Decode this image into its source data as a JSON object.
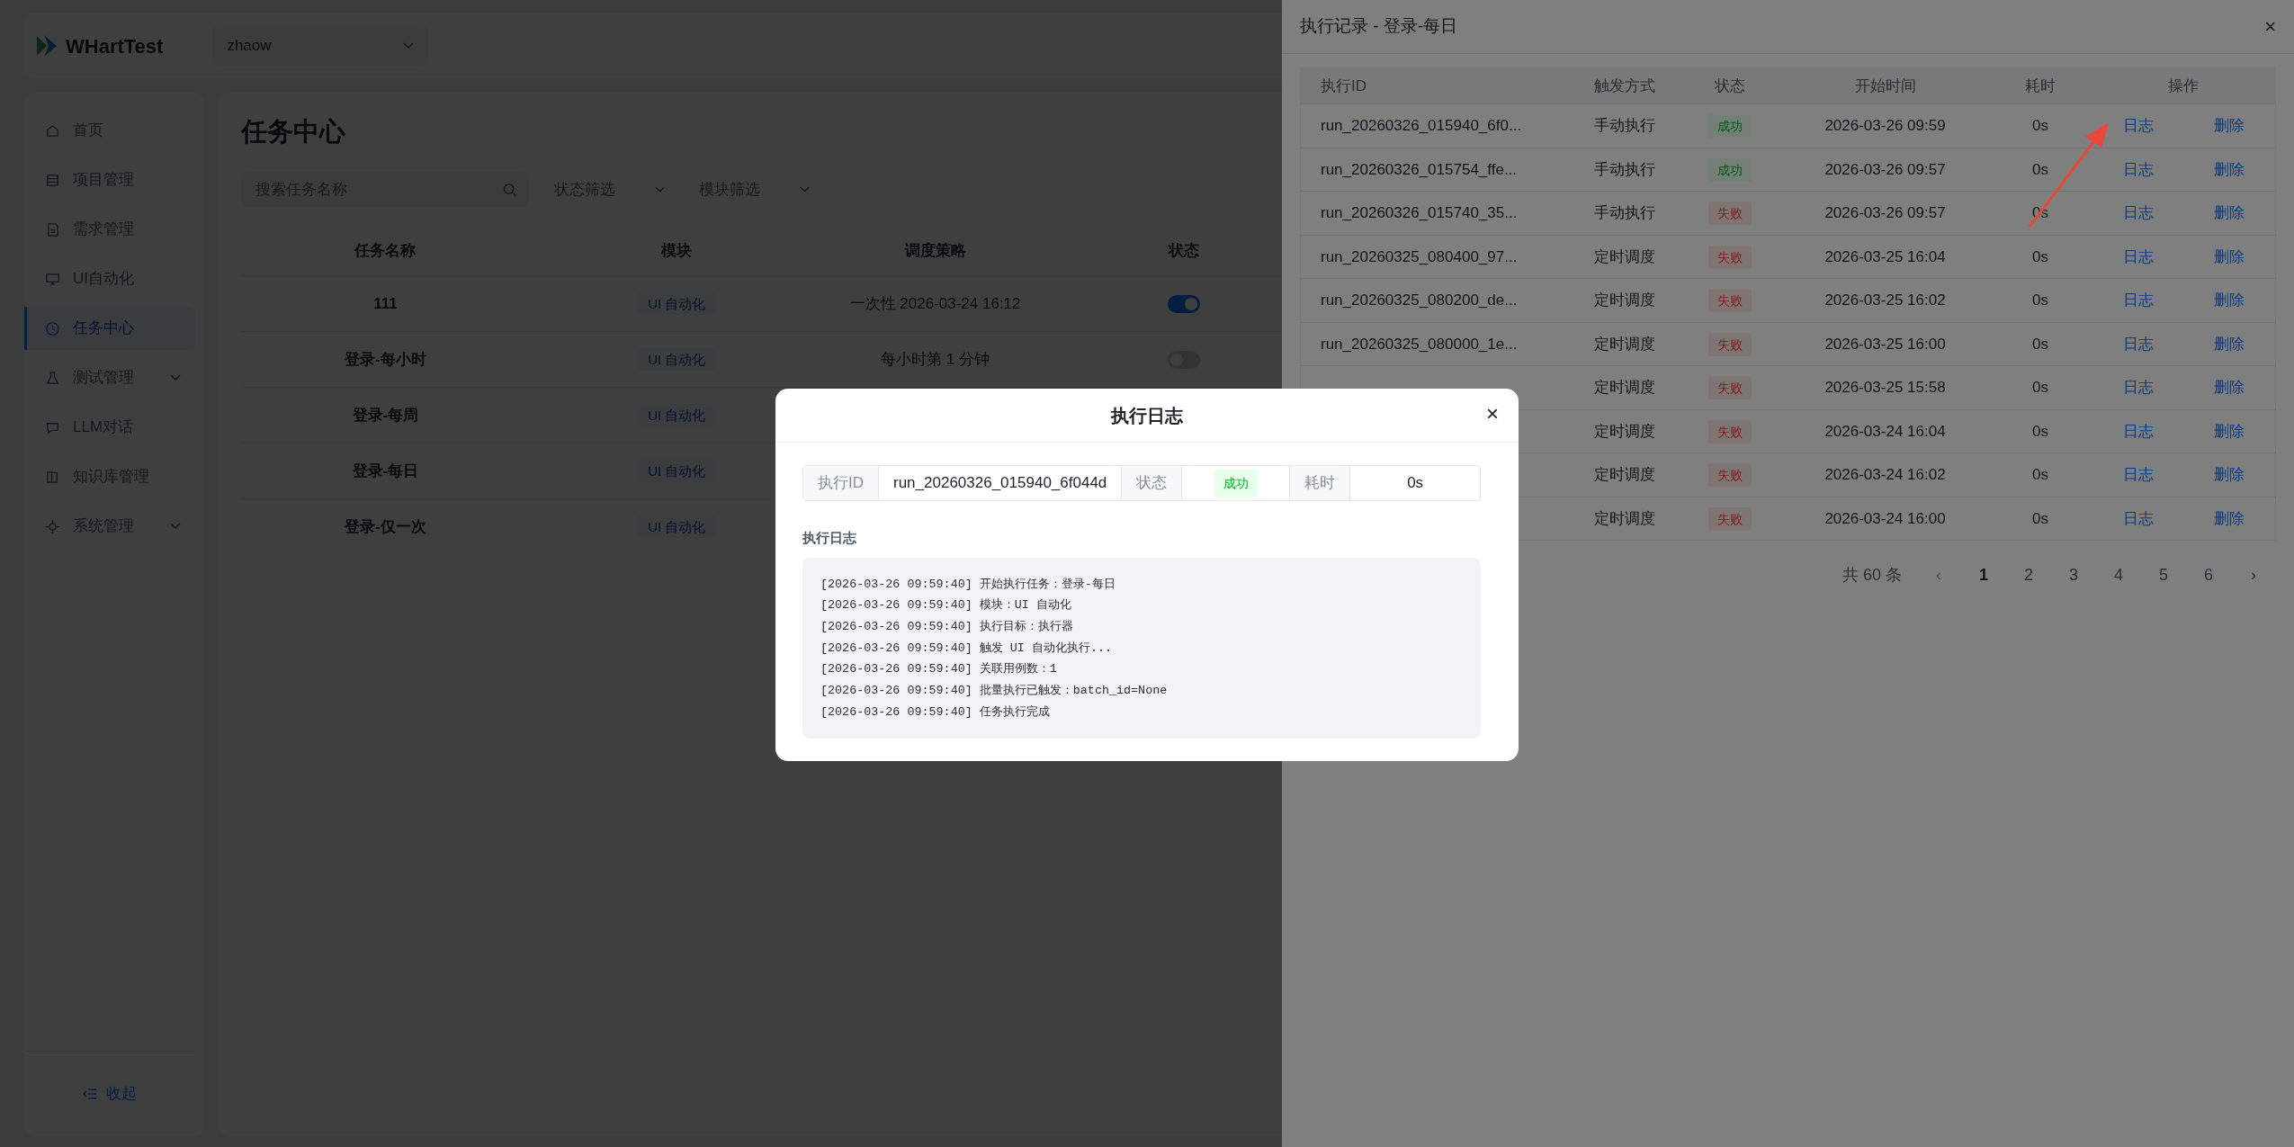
{
  "header": {
    "logo_text": "WHartTest",
    "user_select": "zhaow"
  },
  "sidebar": {
    "items": [
      {
        "label": "首页",
        "selected": false,
        "submenu": false
      },
      {
        "label": "项目管理",
        "selected": false,
        "submenu": false
      },
      {
        "label": "需求管理",
        "selected": false,
        "submenu": false
      },
      {
        "label": "UI自动化",
        "selected": false,
        "submenu": false
      },
      {
        "label": "任务中心",
        "selected": true,
        "submenu": false
      },
      {
        "label": "测试管理",
        "selected": false,
        "submenu": true
      },
      {
        "label": "LLM对话",
        "selected": false,
        "submenu": false
      },
      {
        "label": "知识库管理",
        "selected": false,
        "submenu": false
      },
      {
        "label": "系统管理",
        "selected": false,
        "submenu": true
      }
    ],
    "collapse": "收起"
  },
  "main": {
    "title": "任务中心",
    "search": {
      "placeholder": "搜索任务名称"
    },
    "filters": [
      {
        "placeholder": "状态筛选"
      },
      {
        "placeholder": "模块筛选"
      }
    ],
    "table": {
      "columns": [
        "任务名称",
        "模块",
        "调度策略",
        "状态"
      ],
      "rows": [
        {
          "name": "111",
          "module": "UI 自动化",
          "schedule": "一次性 2026-03-24 16:12",
          "enabled": true
        },
        {
          "name": "登录-每小时",
          "module": "UI 自动化",
          "schedule": "每小时第 1 分钟",
          "enabled": false
        },
        {
          "name": "登录-每周",
          "module": "UI 自动化"
        },
        {
          "name": "登录-每日",
          "module": "UI 自动化"
        },
        {
          "name": "登录-仅一次",
          "module": "UI 自动化"
        }
      ]
    }
  },
  "drawer": {
    "title": "执行记录 - 登录-每日",
    "close": "×",
    "table": {
      "columns": [
        "执行ID",
        "触发方式",
        "状态",
        "开始时间",
        "耗时",
        "操作"
      ],
      "rows": [
        {
          "id": "run_20260326_015940_6f0...",
          "trigger": "手动执行",
          "status": "成功",
          "kind": "success",
          "start": "2026-03-26 09:59",
          "duration": "0s",
          "actions": [
            "日志",
            "删除"
          ]
        },
        {
          "id": "run_20260326_015754_ffe...",
          "trigger": "手动执行",
          "status": "成功",
          "kind": "success",
          "start": "2026-03-26 09:57",
          "duration": "0s",
          "actions": [
            "日志",
            "删除"
          ]
        },
        {
          "id": "run_20260326_015740_35...",
          "trigger": "手动执行",
          "status": "失败",
          "kind": "fail",
          "start": "2026-03-26 09:57",
          "duration": "0s",
          "actions": [
            "日志",
            "删除"
          ]
        },
        {
          "id": "run_20260325_080400_97...",
          "trigger": "定时调度",
          "status": "失败",
          "kind": "fail",
          "start": "2026-03-25 16:04",
          "duration": "0s",
          "actions": [
            "日志",
            "删除"
          ]
        },
        {
          "id": "run_20260325_080200_de...",
          "trigger": "定时调度",
          "status": "失败",
          "kind": "fail",
          "start": "2026-03-25 16:02",
          "duration": "0s",
          "actions": [
            "日志",
            "删除"
          ]
        },
        {
          "id": "run_20260325_080000_1e...",
          "trigger": "定时调度",
          "status": "失败",
          "kind": "fail",
          "start": "2026-03-25 16:00",
          "duration": "0s",
          "actions": [
            "日志",
            "删除"
          ]
        },
        {
          "trigger": "定时调度",
          "status": "失败",
          "kind": "fail",
          "start": "2026-03-25 15:58",
          "duration": "0s",
          "actions": [
            "日志",
            "删除"
          ]
        },
        {
          "trigger": "定时调度",
          "status": "失败",
          "kind": "fail",
          "start": "2026-03-24 16:04",
          "duration": "0s",
          "actions": [
            "日志",
            "删除"
          ]
        },
        {
          "trigger": "定时调度",
          "status": "失败",
          "kind": "fail",
          "start": "2026-03-24 16:02",
          "duration": "0s",
          "actions": [
            "日志",
            "删除"
          ]
        },
        {
          "trigger": "定时调度",
          "status": "失败",
          "kind": "fail",
          "start": "2026-03-24 16:00",
          "duration": "0s",
          "actions": [
            "日志",
            "删除"
          ]
        }
      ]
    },
    "pagination": {
      "total": "共 60 条",
      "prev": {
        "label": "‹",
        "disabled": true
      },
      "pages": [
        {
          "label": "1",
          "selected": true
        },
        {
          "label": "2",
          "selected": false
        },
        {
          "label": "3",
          "selected": false
        },
        {
          "label": "4",
          "selected": false
        },
        {
          "label": "5",
          "selected": false
        },
        {
          "label": "6",
          "selected": false
        }
      ],
      "next": {
        "label": "›",
        "disabled": false
      }
    }
  },
  "modal": {
    "title": "执行日志",
    "close": "×",
    "fields": [
      {
        "label": "执行ID",
        "value": "run_20260326_015940_6f044d",
        "kind": "text"
      },
      {
        "label": "状态",
        "value": "成功",
        "kind": "success"
      },
      {
        "label": "耗时",
        "value": "0s",
        "kind": "text"
      }
    ],
    "log_label": "执行日志",
    "log_lines": [
      "[2026-03-26 09:59:40] 开始执行任务：登录-每日",
      "[2026-03-26 09:59:40] 模块：UI 自动化",
      "[2026-03-26 09:59:40] 执行目标：执行器",
      "[2026-03-26 09:59:40] 触发 UI 自动化执行...",
      "[2026-03-26 09:59:40] 关联用例数：1",
      "[2026-03-26 09:59:40] 批量执行已触发：batch_id=None",
      "[2026-03-26 09:59:40] 任务执行完成"
    ]
  }
}
